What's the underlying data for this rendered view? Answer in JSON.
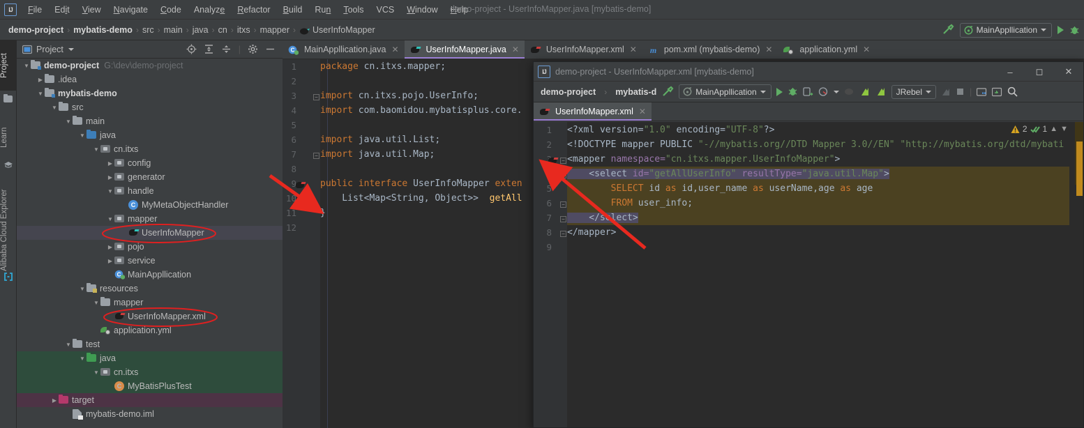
{
  "app": {
    "window_title": "demo-project - UserInfoMapper.java [mybatis-demo]",
    "logo_text": "IJ"
  },
  "menubar": {
    "items": [
      {
        "label": "File"
      },
      {
        "label": "Edit"
      },
      {
        "label": "View"
      },
      {
        "label": "Navigate"
      },
      {
        "label": "Code"
      },
      {
        "label": "Analyze"
      },
      {
        "label": "Refactor"
      },
      {
        "label": "Build"
      },
      {
        "label": "Run"
      },
      {
        "label": "Tools"
      },
      {
        "label": "VCS"
      },
      {
        "label": "Window"
      },
      {
        "label": "Help"
      }
    ]
  },
  "navbar": {
    "crumbs": [
      "demo-project",
      "mybatis-demo",
      "src",
      "main",
      "java",
      "cn",
      "itxs",
      "mapper",
      "UserInfoMapper"
    ],
    "run_config": "MainAppllication",
    "separator": "›"
  },
  "left_strip": {
    "tabs": [
      {
        "label": "Project",
        "icon": "project-icon",
        "active": true
      },
      {
        "label": "Learn",
        "icon": "learn-icon",
        "active": false
      },
      {
        "label": "Alibaba Cloud Explorer",
        "icon": "cloud-icon",
        "active": false
      }
    ]
  },
  "project_panel": {
    "title": "Project",
    "tools": [
      "locate-icon",
      "expand-all-icon",
      "collapse-all-icon",
      "gear-icon",
      "minimize-icon"
    ],
    "tree": [
      {
        "label": "demo-project",
        "path": "G:\\dev\\demo-project",
        "indent": 0,
        "arrow": "v",
        "icon": "module-folder",
        "bold": true,
        "state": ""
      },
      {
        "label": ".idea",
        "path": "",
        "indent": 1,
        "arrow": ">",
        "icon": "folder-grey",
        "bold": false,
        "state": ""
      },
      {
        "label": "mybatis-demo",
        "path": "",
        "indent": 1,
        "arrow": "v",
        "icon": "module-folder",
        "bold": true,
        "state": ""
      },
      {
        "label": "src",
        "path": "",
        "indent": 2,
        "arrow": "v",
        "icon": "folder-grey",
        "bold": false,
        "state": ""
      },
      {
        "label": "main",
        "path": "",
        "indent": 3,
        "arrow": "v",
        "icon": "folder-grey",
        "bold": false,
        "state": ""
      },
      {
        "label": "java",
        "path": "",
        "indent": 4,
        "arrow": "v",
        "icon": "folder-blue",
        "bold": false,
        "state": ""
      },
      {
        "label": "cn.itxs",
        "path": "",
        "indent": 5,
        "arrow": "v",
        "icon": "package",
        "bold": false,
        "state": ""
      },
      {
        "label": "config",
        "path": "",
        "indent": 6,
        "arrow": ">",
        "icon": "package",
        "bold": false,
        "state": ""
      },
      {
        "label": "generator",
        "path": "",
        "indent": 6,
        "arrow": ">",
        "icon": "package",
        "bold": false,
        "state": ""
      },
      {
        "label": "handle",
        "path": "",
        "indent": 6,
        "arrow": "v",
        "icon": "package",
        "bold": false,
        "state": ""
      },
      {
        "label": "MyMetaObjectHandler",
        "path": "",
        "indent": 7,
        "arrow": "",
        "icon": "class",
        "bold": false,
        "state": ""
      },
      {
        "label": "mapper",
        "path": "",
        "indent": 6,
        "arrow": "v",
        "icon": "package",
        "bold": false,
        "state": ""
      },
      {
        "label": "UserInfoMapper",
        "path": "",
        "indent": 7,
        "arrow": "",
        "icon": "mybatis-teal",
        "bold": false,
        "state": "selected"
      },
      {
        "label": "pojo",
        "path": "",
        "indent": 6,
        "arrow": ">",
        "icon": "package",
        "bold": false,
        "state": ""
      },
      {
        "label": "service",
        "path": "",
        "indent": 6,
        "arrow": ">",
        "icon": "package",
        "bold": false,
        "state": ""
      },
      {
        "label": "MainAppllication",
        "path": "",
        "indent": 6,
        "arrow": "",
        "icon": "spring-class",
        "bold": false,
        "state": ""
      },
      {
        "label": "resources",
        "path": "",
        "indent": 4,
        "arrow": "v",
        "icon": "folder-resources",
        "bold": false,
        "state": ""
      },
      {
        "label": "mapper",
        "path": "",
        "indent": 5,
        "arrow": "v",
        "icon": "folder-grey",
        "bold": false,
        "state": ""
      },
      {
        "label": "UserInfoMapper.xml",
        "path": "",
        "indent": 6,
        "arrow": "",
        "icon": "mybatis-red",
        "bold": false,
        "state": ""
      },
      {
        "label": "application.yml",
        "path": "",
        "indent": 5,
        "arrow": "",
        "icon": "yml",
        "bold": false,
        "state": ""
      },
      {
        "label": "test",
        "path": "",
        "indent": 3,
        "arrow": "v",
        "icon": "folder-grey",
        "bold": false,
        "state": ""
      },
      {
        "label": "java",
        "path": "",
        "indent": 4,
        "arrow": "v",
        "icon": "folder-green",
        "bold": false,
        "state": "test"
      },
      {
        "label": "cn.itxs",
        "path": "",
        "indent": 5,
        "arrow": "v",
        "icon": "package",
        "bold": false,
        "state": "test"
      },
      {
        "label": "MyBatisPlusTest",
        "path": "",
        "indent": 6,
        "arrow": "",
        "icon": "test-class",
        "bold": false,
        "state": "test"
      },
      {
        "label": "target",
        "path": "",
        "indent": 2,
        "arrow": ">",
        "icon": "folder-red",
        "bold": false,
        "state": "excluded"
      },
      {
        "label": "mybatis-demo.iml",
        "path": "",
        "indent": 3,
        "arrow": "",
        "icon": "iml",
        "bold": false,
        "state": ""
      }
    ]
  },
  "editor": {
    "tabs": [
      {
        "label": "MainAppllication.java",
        "icon": "spring-class",
        "active": false
      },
      {
        "label": "UserInfoMapper.java",
        "icon": "mybatis-teal",
        "active": true
      },
      {
        "label": "UserInfoMapper.xml",
        "icon": "mybatis-red",
        "active": false
      },
      {
        "label": "pom.xml (mybatis-demo)",
        "icon": "maven",
        "active": false
      },
      {
        "label": "application.yml",
        "icon": "yml",
        "active": false
      }
    ],
    "line_numbers": [
      "1",
      "2",
      "3",
      "4",
      "5",
      "6",
      "7",
      "8",
      "9",
      "10",
      "11",
      "12"
    ],
    "lines": [
      {
        "n": 1,
        "segs": [
          {
            "t": "package ",
            "c": "k"
          },
          {
            "t": "cn.itxs.mapper;",
            "c": "t"
          }
        ]
      },
      {
        "n": 2,
        "segs": []
      },
      {
        "n": 3,
        "segs": [
          {
            "t": "import ",
            "c": "k"
          },
          {
            "t": "cn.itxs.pojo.UserInfo;",
            "c": "t"
          }
        ],
        "fold": true
      },
      {
        "n": 4,
        "segs": [
          {
            "t": "import ",
            "c": "k"
          },
          {
            "t": "com.baomidou.mybatisplus.core.",
            "c": "t"
          }
        ]
      },
      {
        "n": 5,
        "segs": []
      },
      {
        "n": 6,
        "segs": [
          {
            "t": "import ",
            "c": "k"
          },
          {
            "t": "java.util.List;",
            "c": "t"
          }
        ]
      },
      {
        "n": 7,
        "segs": [
          {
            "t": "import ",
            "c": "k"
          },
          {
            "t": "java.util.Map;",
            "c": "t"
          }
        ],
        "fold": true
      },
      {
        "n": 8,
        "segs": []
      },
      {
        "n": 9,
        "segs": [
          {
            "t": "public ",
            "c": "k"
          },
          {
            "t": "interface ",
            "c": "k"
          },
          {
            "t": "UserInfoMapper",
            "c": "ty"
          },
          {
            "t": " exten",
            "c": "k"
          }
        ],
        "gutter": "mybatis-red"
      },
      {
        "n": 10,
        "segs": [
          {
            "t": "    List<Map<String, Object>>  ",
            "c": "t"
          },
          {
            "t": "getAll",
            "c": "m"
          }
        ],
        "gutter": "mybatis-red"
      },
      {
        "n": 11,
        "segs": [
          {
            "t": "}",
            "c": "t"
          }
        ]
      },
      {
        "n": 12,
        "segs": []
      }
    ]
  },
  "float_window": {
    "title": "demo-project - UserInfoMapper.xml [mybatis-demo]",
    "window_buttons": [
      "minimize",
      "maximize",
      "close"
    ],
    "crumbs": [
      "demo-project",
      "mybatis-d"
    ],
    "run_config": "MainAppllication",
    "jrebel_label": "JRebel",
    "tabs": [
      {
        "label": "UserInfoMapper.xml",
        "icon": "mybatis-red",
        "active": true
      }
    ],
    "inspections": {
      "warning_count": "2",
      "ok_count": "1"
    },
    "line_numbers": [
      "1",
      "2",
      "3",
      "4",
      "5",
      "6",
      "7",
      "8",
      "9"
    ],
    "lines": [
      {
        "n": 1,
        "segs": [
          {
            "t": "<?xml version=",
            "c": "t"
          },
          {
            "t": "\"1.0\"",
            "c": "s"
          },
          {
            "t": " encoding=",
            "c": "t"
          },
          {
            "t": "\"UTF-8\"",
            "c": "s"
          },
          {
            "t": "?>",
            "c": "t"
          }
        ]
      },
      {
        "n": 2,
        "segs": [
          {
            "t": "<!DOCTYPE mapper PUBLIC ",
            "c": "t"
          },
          {
            "t": "\"-//mybatis.org//DTD Mapper 3.0//EN\" \"http://mybatis.org/dtd/mybati",
            "c": "s"
          }
        ]
      },
      {
        "n": 3,
        "segs": [
          {
            "t": "<mapper ",
            "c": "t"
          },
          {
            "t": "namespace=",
            "c": "at"
          },
          {
            "t": "\"cn.itxs.mapper.UserInfoMapper\"",
            "c": "s"
          },
          {
            "t": ">",
            "c": "t"
          }
        ],
        "gutter": "mybatis-red",
        "fold": true
      },
      {
        "n": 4,
        "segs": [
          {
            "t": "    <select ",
            "c": "t"
          },
          {
            "t": "id=",
            "c": "at"
          },
          {
            "t": "\"getAllUserInfo\"",
            "c": "s"
          },
          {
            "t": " resultType=",
            "c": "at"
          },
          {
            "t": "\"java.util.Map\"",
            "c": "s"
          },
          {
            "t": ">",
            "c": "t"
          }
        ],
        "gutter": "mybatis-teal",
        "fold": true,
        "highlight": true,
        "selected": true
      },
      {
        "n": 5,
        "segs": [
          {
            "t": "        SELECT ",
            "c": "k"
          },
          {
            "t": "id ",
            "c": "t"
          },
          {
            "t": "as ",
            "c": "k"
          },
          {
            "t": "id,user_name ",
            "c": "t"
          },
          {
            "t": "as ",
            "c": "k"
          },
          {
            "t": "userName,age ",
            "c": "t"
          },
          {
            "t": "as ",
            "c": "k"
          },
          {
            "t": "age",
            "c": "t"
          }
        ],
        "highlight": true
      },
      {
        "n": 6,
        "segs": [
          {
            "t": "        FROM ",
            "c": "k"
          },
          {
            "t": "user_info;",
            "c": "t"
          }
        ],
        "highlight": true,
        "fold": true
      },
      {
        "n": 7,
        "segs": [
          {
            "t": "    </select>",
            "c": "t"
          }
        ],
        "highlight": true,
        "fold": true,
        "selected": true
      },
      {
        "n": 8,
        "segs": [
          {
            "t": "</mapper>",
            "c": "t"
          }
        ],
        "fold": true
      },
      {
        "n": 9,
        "segs": []
      }
    ]
  },
  "annotations": {
    "ellipse_labels": [
      "UserInfoMapper",
      "UserInfoMapper.xml"
    ],
    "arrow_color": "#e8291f",
    "ellipse_color": "#e02020"
  }
}
